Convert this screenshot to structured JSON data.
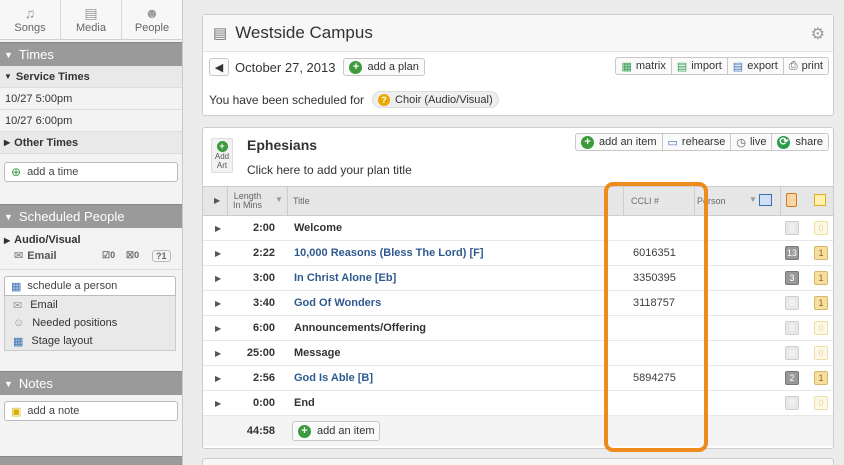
{
  "nav": {
    "songs": "Songs",
    "media": "Media",
    "people": "People"
  },
  "sidebar": {
    "times_header": "Times",
    "service_times_label": "Service Times",
    "service_times": [
      "10/27 5:00pm",
      "10/27 6:00pm"
    ],
    "other_times_label": "Other Times",
    "add_time": "add a time",
    "scheduled_header": "Scheduled People",
    "team_label": "Audio/Visual",
    "email_label": "Email",
    "count_confirmed": "0",
    "count_declined": "0",
    "count_unconfirmed": "1",
    "schedule_person": "schedule a person",
    "menu_email": "Email",
    "menu_needed": "Needed positions",
    "menu_stage": "Stage layout",
    "notes_header": "Notes",
    "add_note": "add a note"
  },
  "plan": {
    "campus": "Westside Campus",
    "date": "October 27, 2013",
    "add_plan": "add a plan",
    "matrix": "matrix",
    "import": "import",
    "export": "export",
    "print": "print",
    "scheduled_text": "You have been scheduled for",
    "position": "Choir (Audio/Visual)"
  },
  "order": {
    "series": "Ephesians",
    "title_placeholder": "Click here to add your plan title",
    "add_art_1": "Add",
    "add_art_2": "Art",
    "add_item": "add an item",
    "rehearse": "rehearse",
    "live": "live",
    "share": "share",
    "col_length_1": "Length",
    "col_length_2": "In Mins",
    "col_title": "Title",
    "col_ccli": "CCLI #",
    "col_person": "Person",
    "items": [
      {
        "length": "2:00",
        "title": "Welcome",
        "song": false,
        "ccli": "",
        "a": "0",
        "b": "0"
      },
      {
        "length": "2:22",
        "title": "10,000 Reasons (Bless The Lord) [F]",
        "song": true,
        "ccli": "6016351",
        "a": "13",
        "b": "1"
      },
      {
        "length": "3:00",
        "title": "In Christ Alone [Eb]",
        "song": true,
        "ccli": "3350395",
        "a": "3",
        "b": "1"
      },
      {
        "length": "3:40",
        "title": "God Of Wonders",
        "song": true,
        "ccli": "3118757",
        "a": "0",
        "b": "1"
      },
      {
        "length": "6:00",
        "title": "Announcements/Offering",
        "song": false,
        "ccli": "",
        "a": "0",
        "b": "0"
      },
      {
        "length": "25:00",
        "title": "Message",
        "song": false,
        "ccli": "",
        "a": "0",
        "b": "0"
      },
      {
        "length": "2:56",
        "title": "God Is Able [B]",
        "song": true,
        "ccli": "5894275",
        "a": "2",
        "b": "1"
      },
      {
        "length": "0:00",
        "title": "End",
        "song": false,
        "ccli": "",
        "a": "0",
        "b": "0"
      }
    ],
    "total": "44:58",
    "add_item_bottom": "add an item"
  },
  "colors": {
    "song_title": "#2f5a8f",
    "highlight": "#ef8a1c",
    "section": "#9a9a9a"
  }
}
